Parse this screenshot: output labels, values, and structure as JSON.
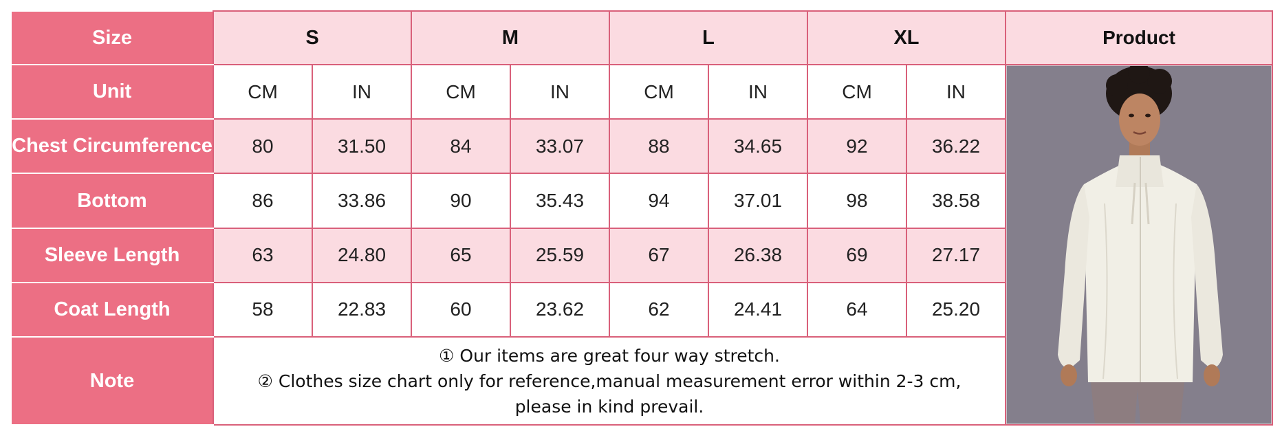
{
  "table": {
    "row_headers": {
      "size": "Size",
      "unit": "Unit",
      "note": "Note"
    },
    "product_header": "Product",
    "sizes": [
      "S",
      "M",
      "L",
      "XL"
    ],
    "units": [
      "CM",
      "IN",
      "CM",
      "IN",
      "CM",
      "IN",
      "CM",
      "IN"
    ],
    "rows": [
      {
        "label": "Chest Circumference",
        "values": [
          "80",
          "31.50",
          "84",
          "33.07",
          "88",
          "34.65",
          "92",
          "36.22"
        ]
      },
      {
        "label": "Bottom",
        "values": [
          "86",
          "33.86",
          "90",
          "35.43",
          "94",
          "37.01",
          "98",
          "38.58"
        ]
      },
      {
        "label": "Sleeve Length",
        "values": [
          "63",
          "24.80",
          "65",
          "25.59",
          "67",
          "26.38",
          "69",
          "27.17"
        ]
      },
      {
        "label": "Coat Length",
        "values": [
          "58",
          "22.83",
          "60",
          "23.62",
          "62",
          "24.41",
          "64",
          "25.20"
        ]
      }
    ],
    "notes": [
      "① Our items are great four way stretch.",
      "② Clothes size chart only for reference,manual measurement error within 2-3 cm,",
      "please in kind prevail."
    ]
  },
  "colors": {
    "header_pink": "#ec6f84",
    "light_pink": "#fbdbe1",
    "border": "#d9607a",
    "photo_background": "#847f8c",
    "jacket": "#f1efe6",
    "leggings": "#8d7d80"
  },
  "product_image": "woman-in-white-zip-jacket"
}
